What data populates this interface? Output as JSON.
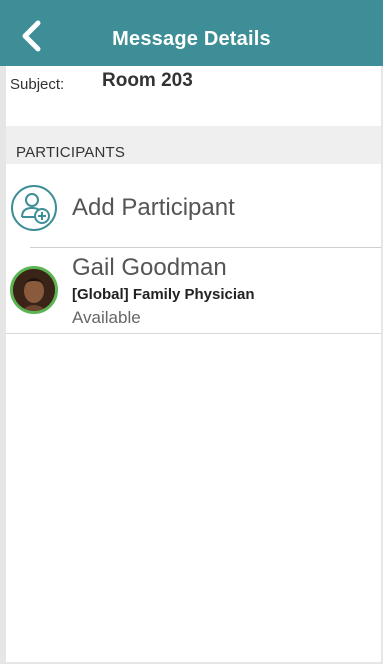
{
  "header": {
    "title": "Message Details",
    "back_icon": "chevron-left-icon",
    "color": "#3d8e96"
  },
  "subject": {
    "label": "Subject:",
    "value": "Room 203"
  },
  "participants_section": {
    "label": "PARTICIPANTS"
  },
  "add_participant": {
    "label": "Add Participant",
    "icon": "add-user-icon"
  },
  "participants": [
    {
      "name": "Gail Goodman",
      "role": "[Global] Family Physician",
      "status": "Available",
      "status_color": "#5ab552"
    }
  ]
}
